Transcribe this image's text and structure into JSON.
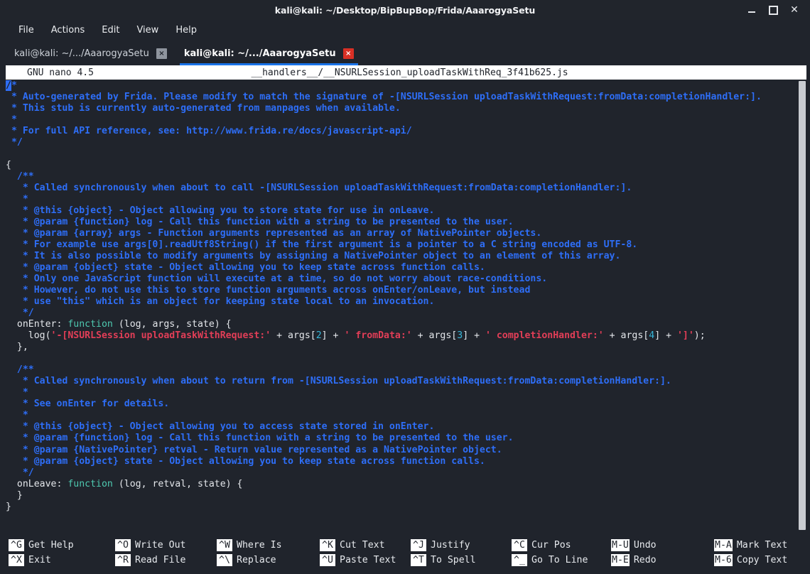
{
  "window": {
    "title": "kali@kali: ~/Desktop/BipBupBop/Frida/AaarogyaSetu",
    "controls": {
      "minimize": "minimize-icon",
      "maximize": "maximize-icon",
      "close": "✕"
    }
  },
  "menubar": {
    "items": [
      "File",
      "Actions",
      "Edit",
      "View",
      "Help"
    ]
  },
  "tabs": [
    {
      "label": "kali@kali: ~/.../AaarogyaSetu",
      "active": false,
      "close": "×"
    },
    {
      "label": "kali@kali: ~/.../AaarogyaSetu",
      "active": true,
      "close": "×"
    }
  ],
  "nano": {
    "version": "GNU nano 4.5",
    "filename": "__handlers__/__NSURLSession_uploadTaskWithReq_3f41b625.js"
  },
  "editor": {
    "lines": [
      "/*",
      " * Auto-generated by Frida. Please modify to match the signature of -[NSURLSession uploadTaskWithRequest:fromData:completionHandler:].",
      " * This stub is currently auto-generated from manpages when available.",
      " *",
      " * For full API reference, see: http://www.frida.re/docs/javascript-api/",
      " */",
      "",
      "{",
      "  /**",
      "   * Called synchronously when about to call -[NSURLSession uploadTaskWithRequest:fromData:completionHandler:].",
      "   *",
      "   * @this {object} - Object allowing you to store state for use in onLeave.",
      "   * @param {function} log - Call this function with a string to be presented to the user.",
      "   * @param {array} args - Function arguments represented as an array of NativePointer objects.",
      "   * For example use args[0].readUtf8String() if the first argument is a pointer to a C string encoded as UTF-8.",
      "   * It is also possible to modify arguments by assigning a NativePointer object to an element of this array.",
      "   * @param {object} state - Object allowing you to keep state across function calls.",
      "   * Only one JavaScript function will execute at a time, so do not worry about race-conditions.",
      "   * However, do not use this to store function arguments across onEnter/onLeave, but instead",
      "   * use \"this\" which is an object for keeping state local to an invocation.",
      "   */",
      "  onEnter: function (log, args, state) {",
      "    log('-[NSURLSession uploadTaskWithRequest:' + args[2] + ' fromData:' + args[3] + ' completionHandler:' + args[4] + ']');",
      "  },",
      "",
      "  /**",
      "   * Called synchronously when about to return from -[NSURLSession uploadTaskWithRequest:fromData:completionHandler:].",
      "   *",
      "   * See onEnter for details.",
      "   *",
      "   * @this {object} - Object allowing you to access state stored in onEnter.",
      "   * @param {function} log - Call this function with a string to be presented to the user.",
      "   * @param {NativePointer} retval - Return value represented as a NativePointer object.",
      "   * @param {object} state - Object allowing you to keep state across function calls.",
      "   */",
      "  onLeave: function (log, retval, state) {",
      "  }",
      "}"
    ],
    "cursor": {
      "line": 0,
      "col": 0
    }
  },
  "shortcuts": [
    [
      {
        "key": "^G",
        "label": "Get Help"
      },
      {
        "key": "^X",
        "label": "Exit"
      }
    ],
    [
      {
        "key": "^O",
        "label": "Write Out"
      },
      {
        "key": "^R",
        "label": "Read File"
      }
    ],
    [
      {
        "key": "^W",
        "label": "Where Is"
      },
      {
        "key": "^\\",
        "label": "Replace"
      }
    ],
    [
      {
        "key": "^K",
        "label": "Cut Text"
      },
      {
        "key": "^U",
        "label": "Paste Text"
      }
    ],
    [
      {
        "key": "^J",
        "label": "Justify"
      },
      {
        "key": "^T",
        "label": "To Spell"
      }
    ],
    [
      {
        "key": "^C",
        "label": "Cur Pos"
      },
      {
        "key": "^_",
        "label": "Go To Line"
      }
    ],
    [
      {
        "key": "M-U",
        "label": "Undo"
      },
      {
        "key": "M-E",
        "label": "Redo"
      }
    ],
    [
      {
        "key": "M-A",
        "label": "Mark Text"
      },
      {
        "key": "M-6",
        "label": "Copy Text"
      }
    ]
  ],
  "colors": {
    "background": "#20242c",
    "titlebar": "#21252c",
    "comment": "#2e6ef7",
    "keyword": "#4ec9b0",
    "string": "#e23e57",
    "number": "#36b6d9",
    "accent": "#1a73e8",
    "close_active": "#d93025"
  }
}
